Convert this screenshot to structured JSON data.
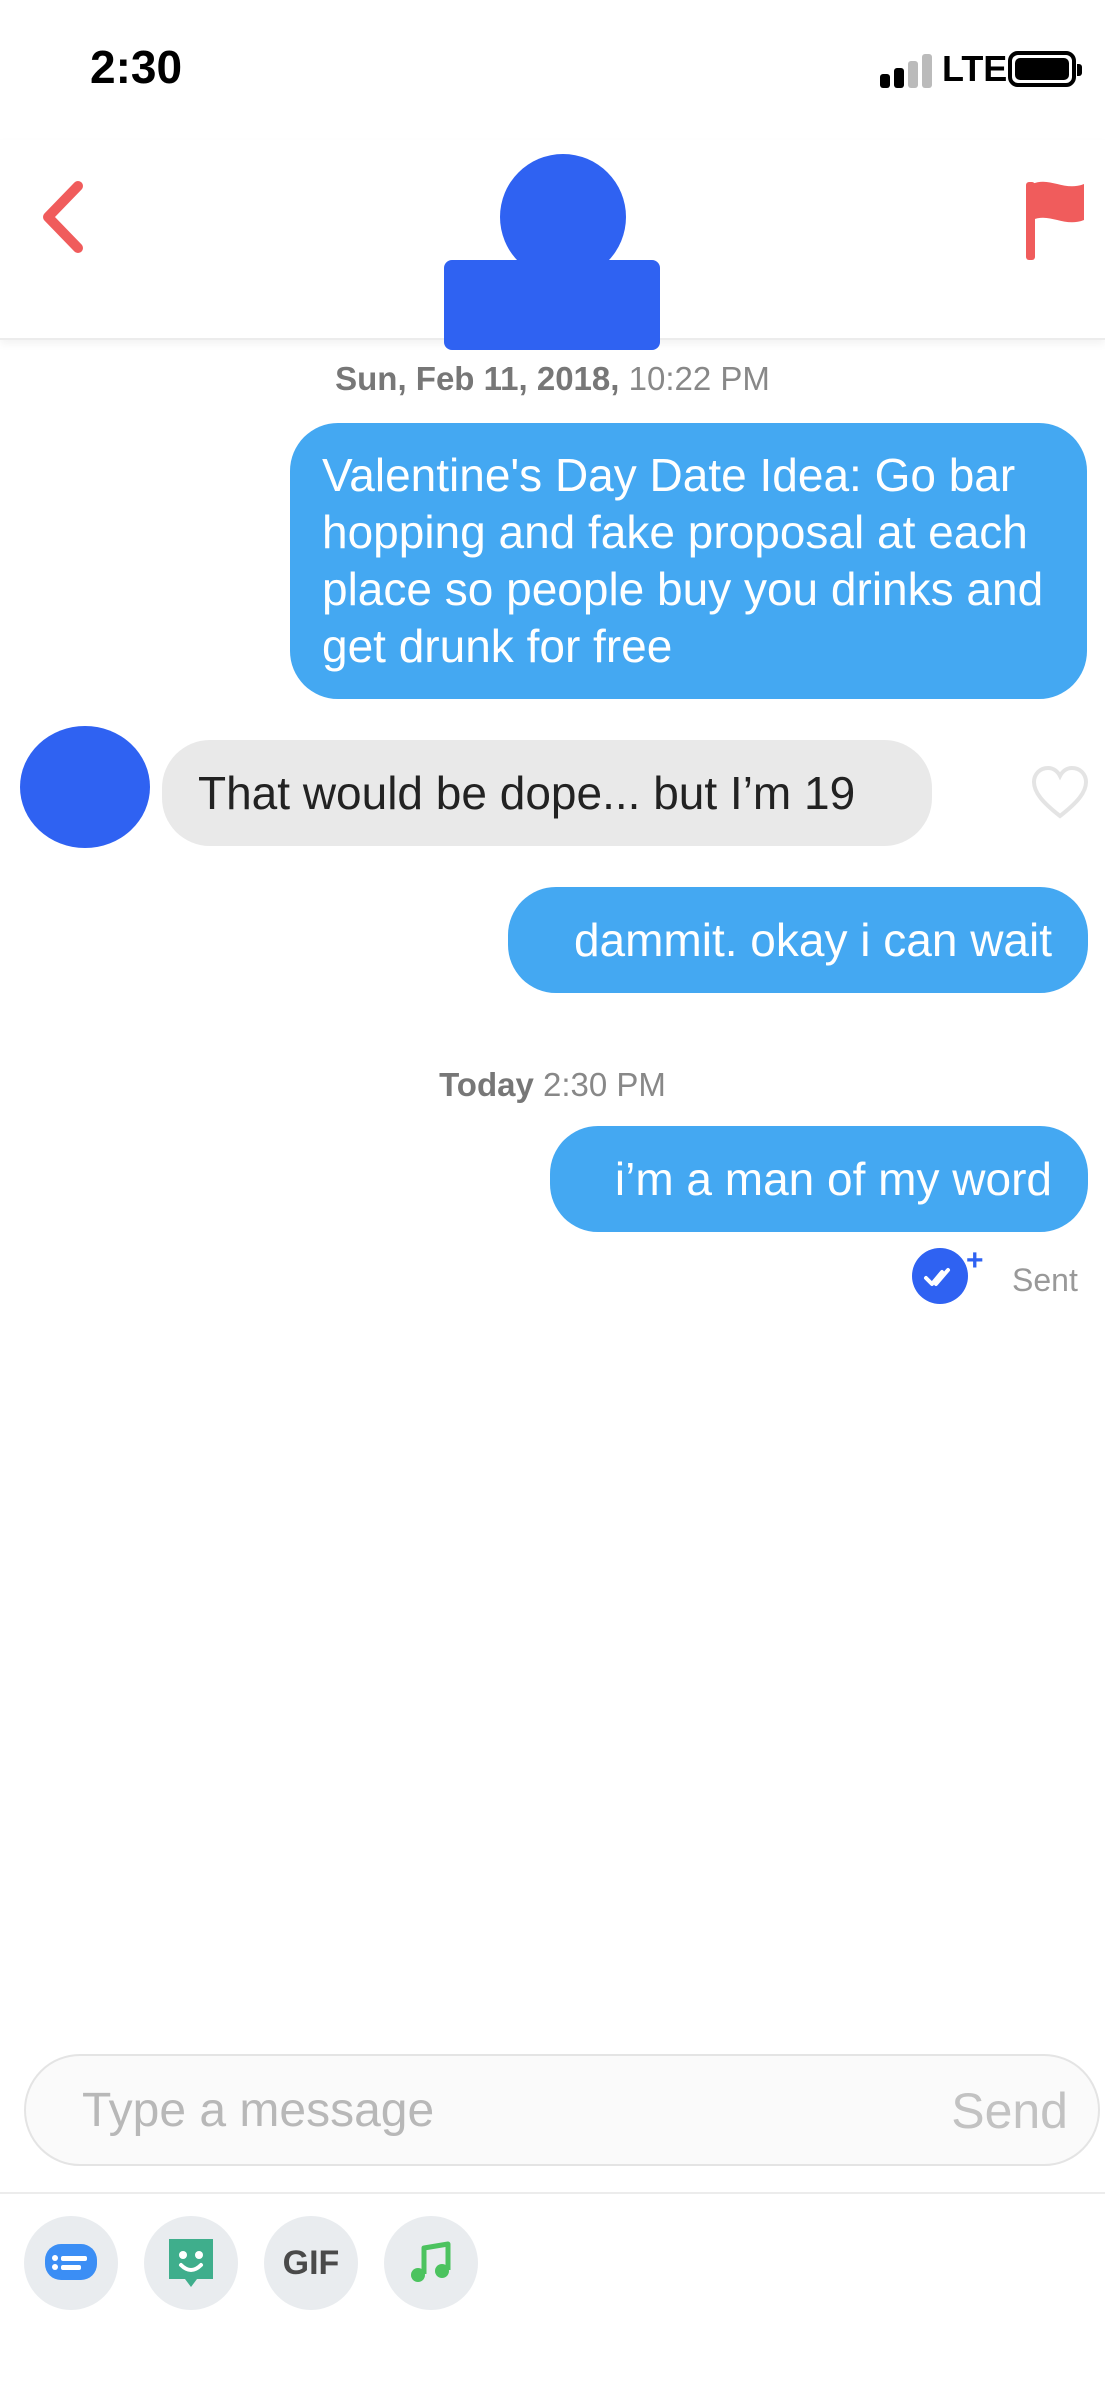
{
  "status_bar": {
    "time": "2:30",
    "network": "LTE"
  },
  "header": {
    "back_icon": "chevron-left-icon",
    "report_icon": "flag-icon",
    "accent_color": "#f05c5c"
  },
  "conversation": {
    "date_header_1": {
      "day": "Sun, Feb 11, 2018,",
      "time": "10:22 PM"
    },
    "messages": [
      {
        "direction": "sent",
        "text": "Valentine's Day Date Idea: Go bar hopping and fake proposal at each place so people buy you drinks and get drunk for free"
      },
      {
        "direction": "received",
        "text": "That would be dope... but I’m 19"
      },
      {
        "direction": "sent",
        "text": "dammit. okay i can wait"
      },
      {
        "direction": "sent",
        "text": "i’m a man of my word"
      }
    ],
    "date_header_2": {
      "day": "Today",
      "time": "2:30 PM"
    },
    "receipt": {
      "icon": "read-receipt-plus-icon",
      "plus": "+",
      "label": "Sent"
    },
    "colors": {
      "sent_bubble": "#44a8f2",
      "received_bubble": "#e9e9e9",
      "receipt": "#2f62f2"
    }
  },
  "composer": {
    "placeholder": "Type a message",
    "value": "",
    "send_label": "Send"
  },
  "toolbar": {
    "items": [
      {
        "icon": "chat-bubble-icon",
        "color": "#3b8ef5"
      },
      {
        "icon": "sticker-icon",
        "color": "#3fae8c"
      },
      {
        "icon": "gif-icon",
        "label": "GIF"
      },
      {
        "icon": "music-note-icon",
        "color": "#4cc35f"
      }
    ]
  }
}
